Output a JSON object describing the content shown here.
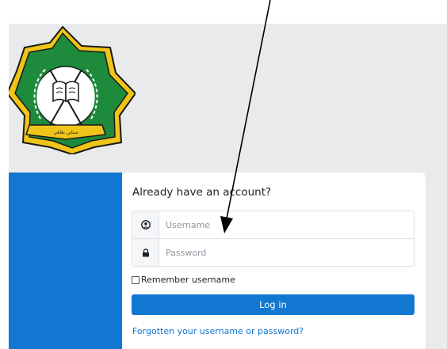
{
  "logo": {
    "name": "institution-emblem",
    "ribbon_text": "ستاين بغاهي",
    "colors": {
      "green": "#1e8a3c",
      "gold": "#f0c419",
      "dark": "#1a1a1a"
    }
  },
  "login": {
    "heading": "Already have an account?",
    "username": {
      "placeholder": "Username",
      "icon": "user-circle-icon"
    },
    "password": {
      "placeholder": "Password",
      "icon": "lock-icon"
    },
    "remember_label": "Remember username",
    "remember_checked": false,
    "login_button": "Log in",
    "forgot_link": "Forgotten your username or password?"
  },
  "theme": {
    "primary": "#1177d1",
    "background": "#e9eaec",
    "card": "#ffffff"
  },
  "annotation": {
    "type": "arrow",
    "color": "#000000",
    "points_to": "username-input"
  }
}
